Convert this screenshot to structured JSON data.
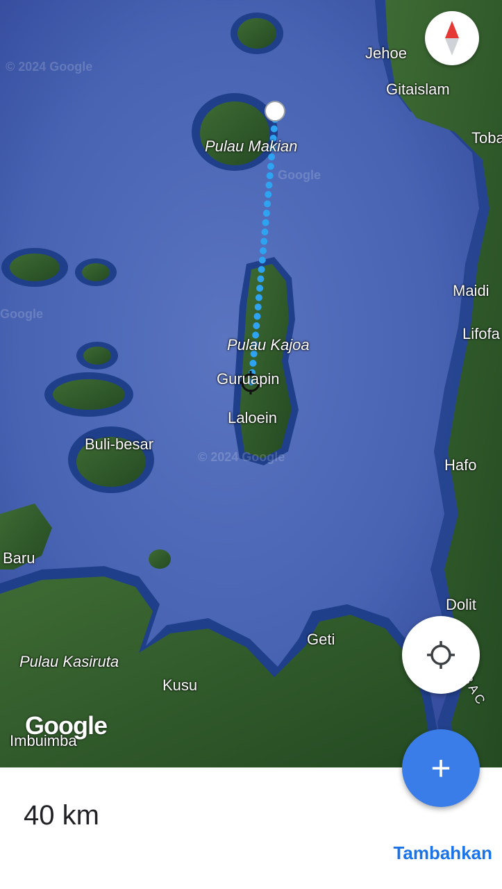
{
  "map": {
    "labels": {
      "jehoe": "Jehoe",
      "gitaislam": "Gitaislam",
      "toba": "Toba",
      "pulau_makian": "Pulau Makian",
      "maidi": "Maidi",
      "lifofa": "Lifofa",
      "pulau_kajoa": "Pulau Kajoa",
      "guruapin": "Guruapin",
      "laloein": "Laloein",
      "buli_besar": "Buli-besar",
      "hafo": "Hafo",
      "baru": "Baru",
      "dolit": "Dolit",
      "geti": "Geti",
      "pulau_kasiruta": "Pulau Kasiruta",
      "kusu": "Kusu",
      "imbuimba": "Imbuimba",
      "bac": "B A C"
    },
    "watermarks": [
      "© 2024 Google",
      "© 2024 Google",
      "Google",
      "Google"
    ],
    "logo": "Google",
    "measure_line_color": "#2ea3f2",
    "water_color": "#3d5aa8",
    "land_color": "#2f5a2c"
  },
  "controls": {
    "compass_icon": "compass-icon",
    "locate_icon": "my-location-icon",
    "add_icon": "plus-icon",
    "add_symbol": "+"
  },
  "bottom": {
    "distance": "40 km",
    "add_label": "Tambahkan"
  }
}
